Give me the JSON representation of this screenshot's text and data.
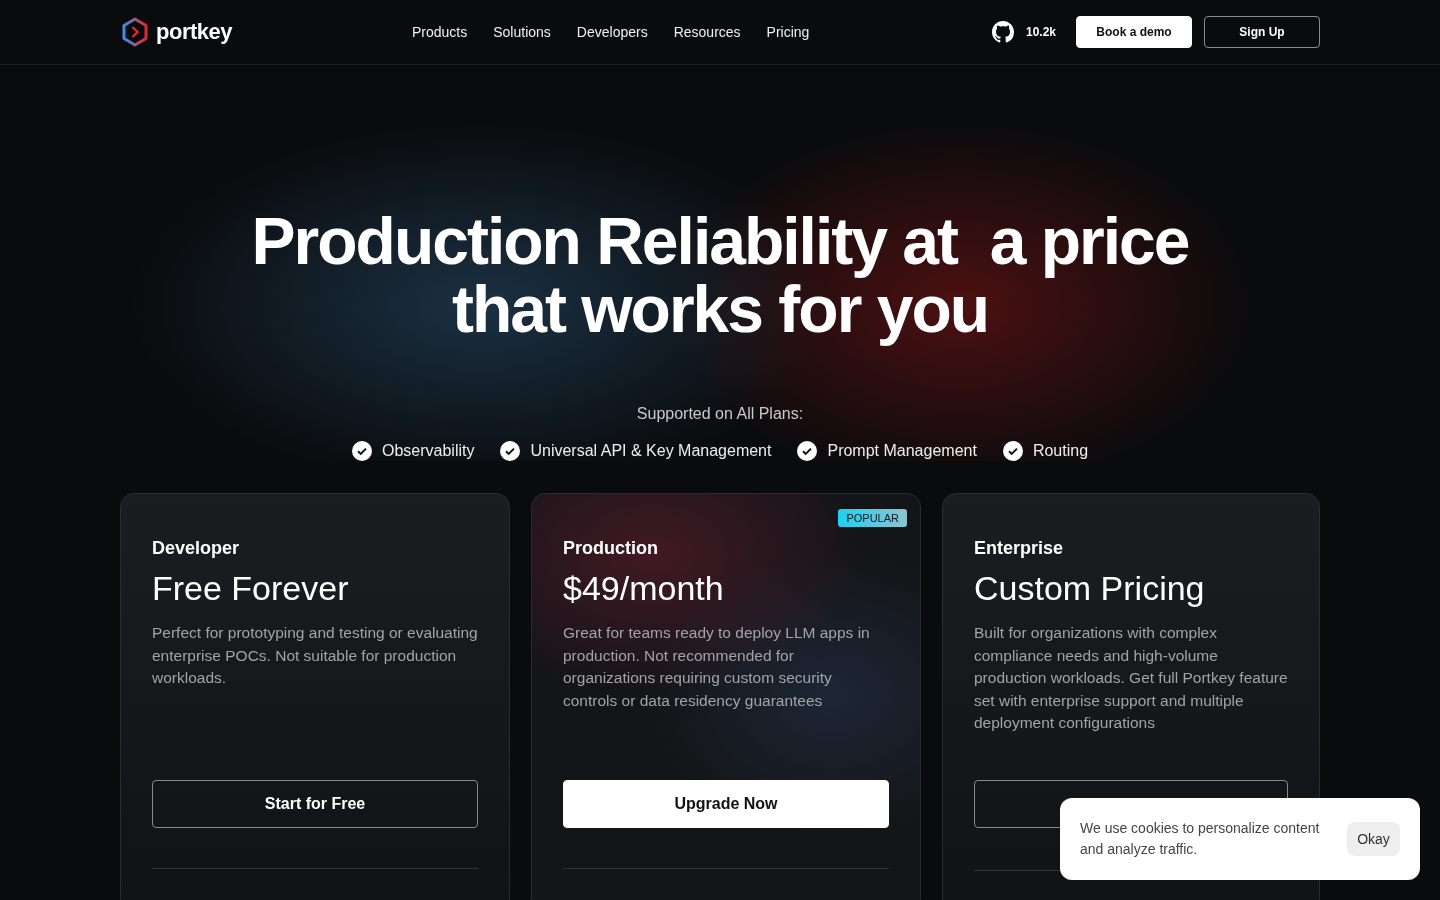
{
  "nav": {
    "brand": "portkey",
    "links": [
      "Products",
      "Solutions",
      "Developers",
      "Resources",
      "Pricing"
    ],
    "stars": "10.2k",
    "buttons": [
      {
        "label": "Book a demo",
        "kind": "filled"
      },
      {
        "label": "Sign Up",
        "kind": "outline"
      }
    ]
  },
  "hero": {
    "title_lines": [
      "Production Reliability at  a price",
      "that works for you"
    ],
    "supported_label": "Supported on All Plans:",
    "features": [
      "Observability",
      "Universal API & Key Management",
      "Prompt Management",
      "Routing"
    ]
  },
  "plans": [
    {
      "name": "Developer",
      "price": "Free Forever",
      "description": "Perfect for prototyping and testing or evaluating enterprise POCs. Not suitable for production workloads.",
      "button": {
        "label": "Start for Free",
        "kind": "outline"
      }
    },
    {
      "name": "Production",
      "price": "$49/month",
      "badge": "POPULAR",
      "description": "Great for teams ready to deploy LLM apps in production. Not recommended for organizations requiring custom security controls or data residency guarantees",
      "button": {
        "label": "Upgrade Now",
        "kind": "filled"
      }
    },
    {
      "name": "Enterprise",
      "price": "Custom Pricing",
      "description": "Built for organizations with complex compliance needs and high-volume production workloads. Get full Portkey feature set with enterprise support and multiple deployment configurations",
      "button": {
        "kind": "outline"
      }
    }
  ],
  "cookie_banner": {
    "message": "We use cookies to personalize content and analyze traffic.",
    "button": "Okay"
  }
}
